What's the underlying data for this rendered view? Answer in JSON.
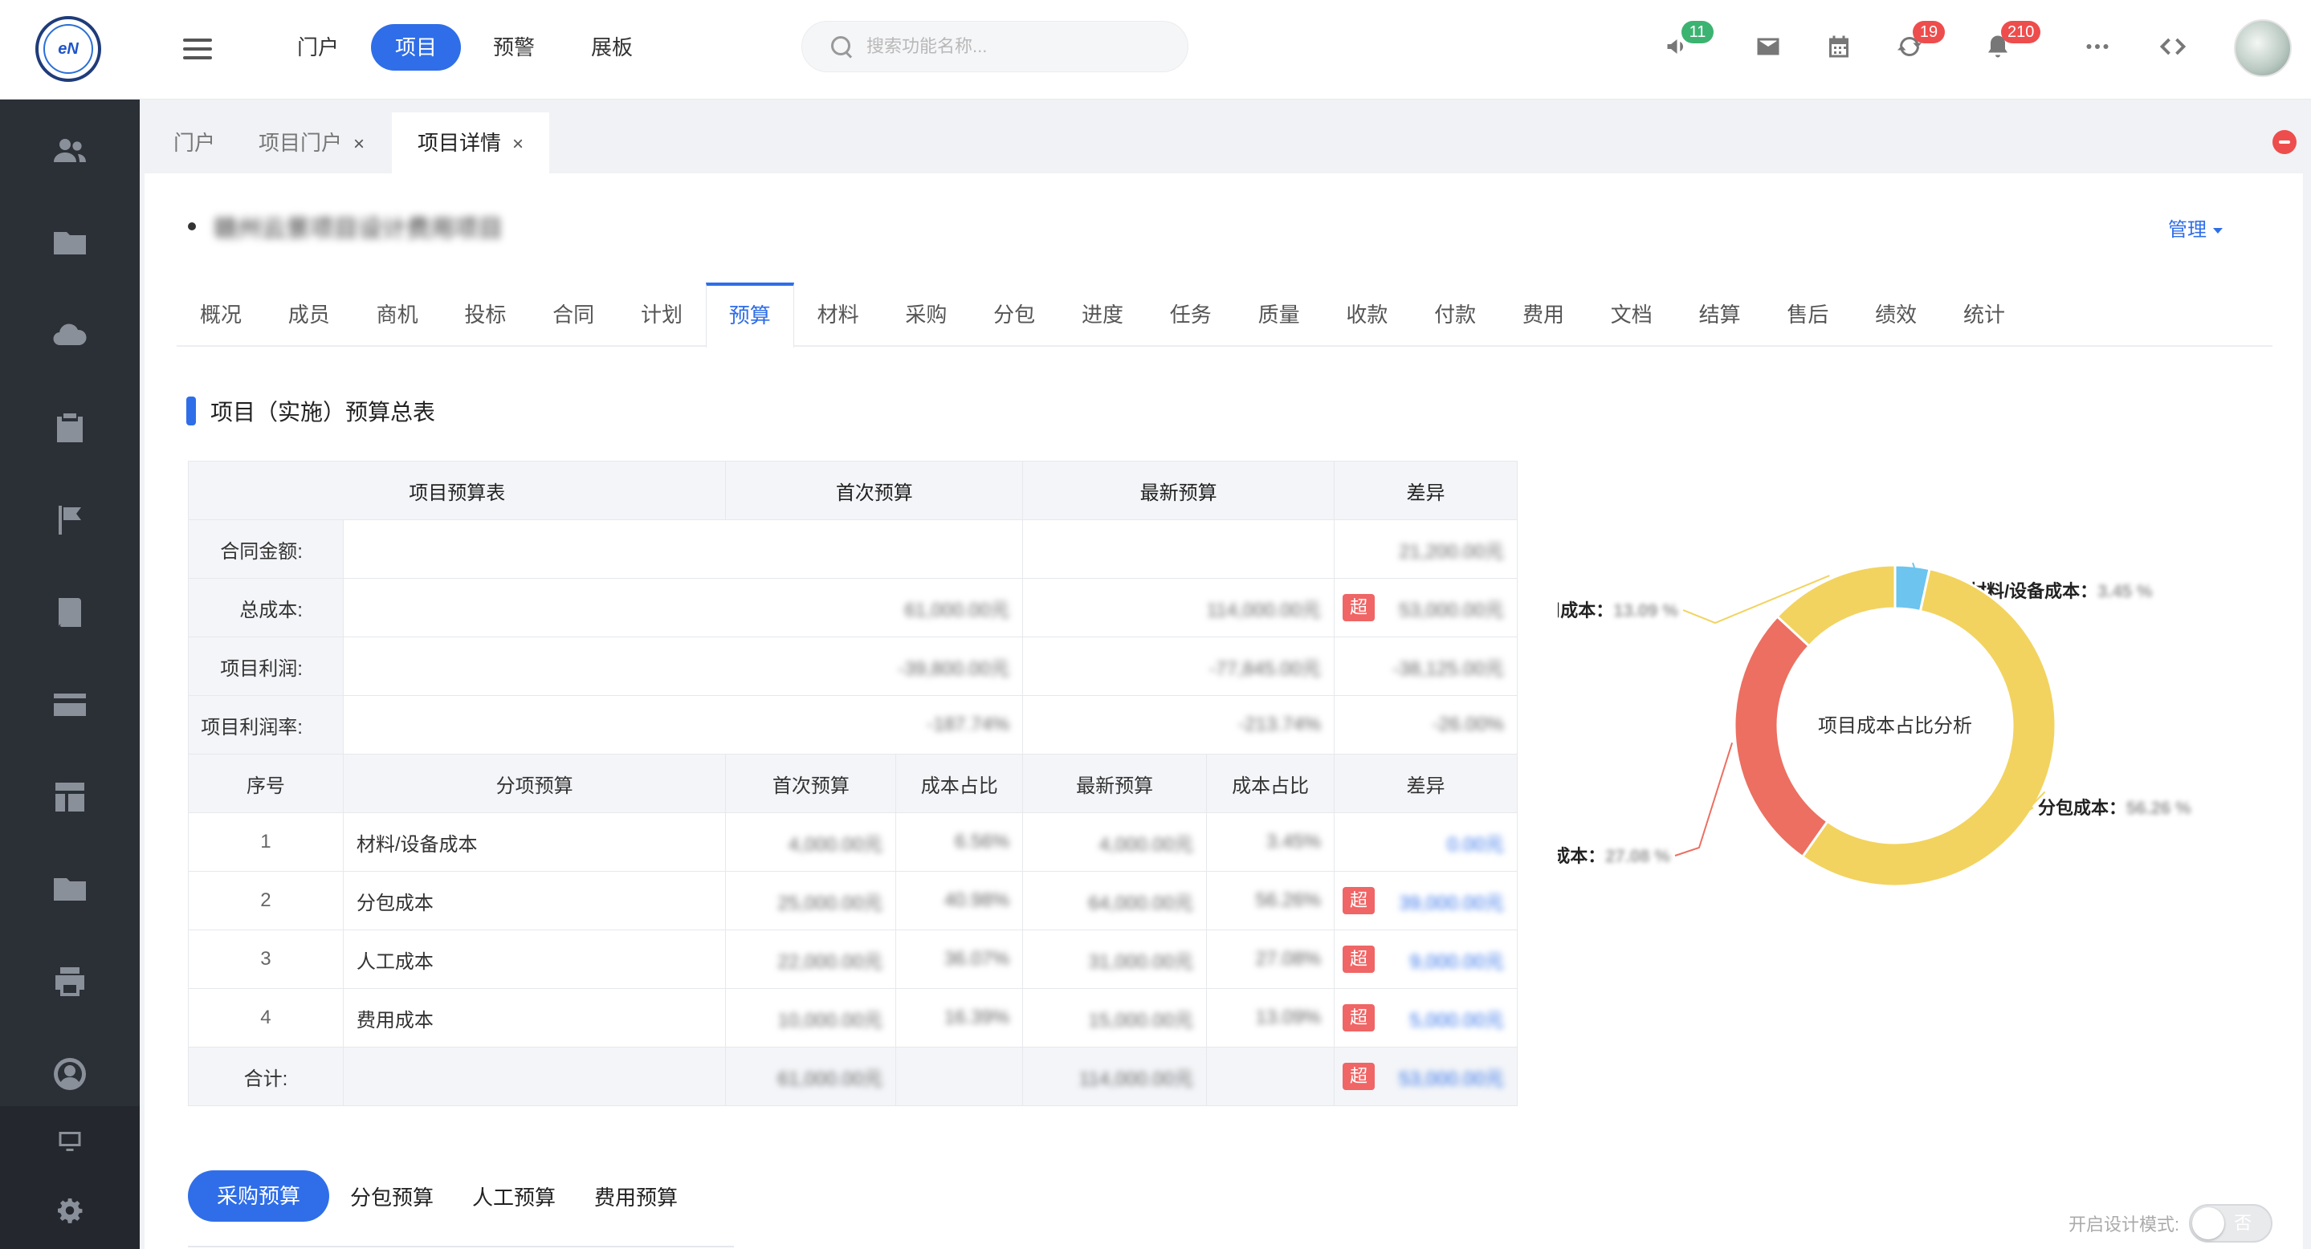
{
  "header": {
    "nav": [
      "门户",
      "项目",
      "预警",
      "展板"
    ],
    "nav_active": "项目",
    "search_placeholder": "搜索功能名称...",
    "badges": {
      "announcements": "11",
      "sync": "19",
      "notifications": "210"
    }
  },
  "page_tabs": [
    {
      "label": "门户"
    },
    {
      "label": "项目门户"
    },
    {
      "label": "项目详情"
    }
  ],
  "project": {
    "name": "赣州云景项目设计费用项目",
    "manage_label": "管理"
  },
  "sub_tabs": [
    "概况",
    "成员",
    "商机",
    "投标",
    "合同",
    "计划",
    "预算",
    "材料",
    "采购",
    "分包",
    "进度",
    "任务",
    "质量",
    "收款",
    "付款",
    "费用",
    "文档",
    "结算",
    "售后",
    "绩效",
    "统计"
  ],
  "sub_tab_active": "预算",
  "section_title": "项目（实施）预算总表",
  "budget_table": {
    "headers": [
      "项目预算表",
      "首次预算",
      "最新预算",
      "差异"
    ],
    "summary_rows": [
      {
        "label": "合同金额:",
        "first": "",
        "latest": "",
        "diff": "21,200.00元"
      },
      {
        "label": "总成本:",
        "first": "61,000.00元",
        "latest": "114,000.00元",
        "over": "超",
        "diff": "53,000.00元"
      },
      {
        "label": "项目利润:",
        "first": "-39,800.00元",
        "latest": "-77,845.00元",
        "diff": "-38,125.00元"
      },
      {
        "label": "项目利润率:",
        "first": "-187.74%",
        "latest": "-213.74%",
        "diff": "-26.00%"
      }
    ],
    "detail_headers": [
      "序号",
      "分项预算",
      "首次预算",
      "成本占比",
      "最新预算",
      "成本占比",
      "差异"
    ],
    "detail_rows": [
      {
        "no": "1",
        "name": "材料/设备成本",
        "first": "4,000.00元",
        "first_ratio": "6.56%",
        "latest": "4,000.00元",
        "latest_ratio": "3.45%",
        "over": "",
        "diff": "0.00元"
      },
      {
        "no": "2",
        "name": "分包成本",
        "first": "25,000.00元",
        "first_ratio": "40.98%",
        "latest": "64,000.00元",
        "latest_ratio": "56.26%",
        "over": "超",
        "diff": "39,000.00元"
      },
      {
        "no": "3",
        "name": "人工成本",
        "first": "22,000.00元",
        "first_ratio": "36.07%",
        "latest": "31,000.00元",
        "latest_ratio": "27.08%",
        "over": "超",
        "diff": "9,000.00元"
      },
      {
        "no": "4",
        "name": "费用成本",
        "first": "10,000.00元",
        "first_ratio": "16.39%",
        "latest": "15,000.00元",
        "latest_ratio": "13.09%",
        "over": "超",
        "diff": "5,000.00元"
      }
    ],
    "total": {
      "label": "合计:",
      "first": "61,000.00元",
      "latest": "114,000.00元",
      "over": "超",
      "diff": "53,000.00元"
    }
  },
  "chart_data": {
    "type": "pie",
    "donut": true,
    "title": "项目成本占比分析",
    "series": [
      {
        "name": "材料/设备成本",
        "value": 3.45,
        "color": "#6cc4ef",
        "value_label": "3.45 %"
      },
      {
        "name": "分包成本",
        "value": 56.26,
        "color": "#f2d35f",
        "value_label": "56.26 %"
      },
      {
        "name": "人工成本",
        "value": 27.08,
        "color": "#ec6f61",
        "value_label": "27.08 %"
      },
      {
        "name": "费用成本",
        "value": 13.09,
        "color": "#f2d35f",
        "value_label": "13.09 %"
      }
    ]
  },
  "bottom_tabs": [
    "采购预算",
    "分包预算",
    "人工预算",
    "费用预算"
  ],
  "design_mode": {
    "label": "开启设计模式:",
    "state": "否"
  }
}
